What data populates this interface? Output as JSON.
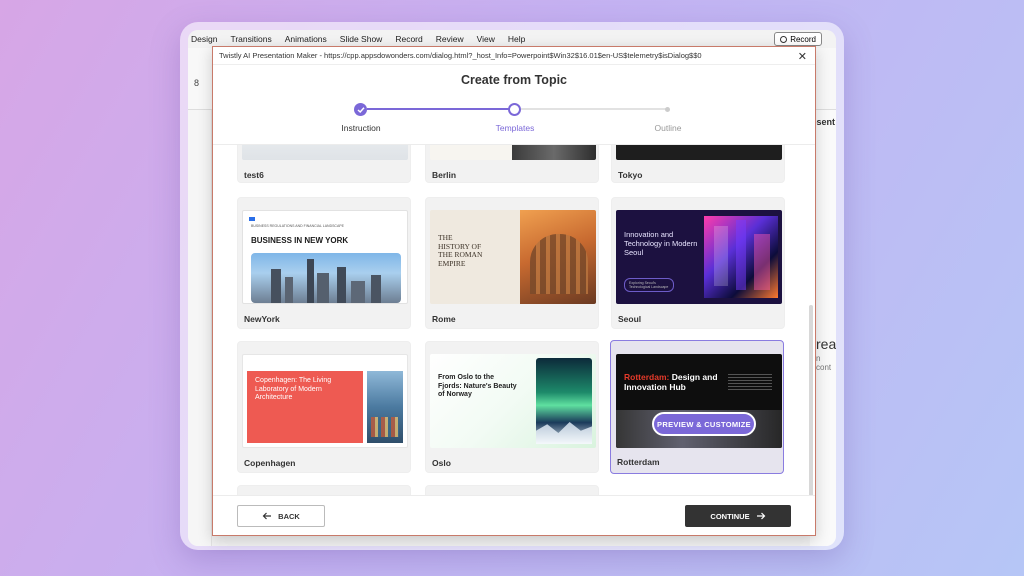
{
  "ribbon": {
    "tabs": [
      "Design",
      "Transitions",
      "Animations",
      "Slide Show",
      "Record",
      "Review",
      "View",
      "Help"
    ],
    "record_label": "Record",
    "slide_number": "8",
    "behind_text_1": "resent",
    "behind_text_2": "reat",
    "behind_text_3": "n cont"
  },
  "dialog": {
    "window_title": "Twistly AI Presentation Maker - https://cpp.appsdowonders.com/dialog.html?_host_Info=Powerpoint$Win32$16.01$en-US$telemetry$isDialog$$0",
    "close_label": "✕",
    "title": "Create from Topic",
    "steps": [
      {
        "label": "Instruction",
        "state": "done"
      },
      {
        "label": "Templates",
        "state": "active"
      },
      {
        "label": "Outline",
        "state": "pending"
      }
    ],
    "accent_color": "#7b68d8",
    "back_label": "BACK",
    "continue_label": "CONTINUE"
  },
  "templates": {
    "row0": [
      "test6",
      "Berlin",
      "Tokyo"
    ],
    "newyork": {
      "name": "NewYork",
      "kicker": "BUSINESS REGULATIONS AND FINANCIAL LANDSCAPE",
      "headline": "BUSINESS IN NEW YORK"
    },
    "rome": {
      "name": "Rome",
      "headline": "THE HISTORY OF THE ROMAN EMPIRE"
    },
    "seoul": {
      "name": "Seoul",
      "headline": "Innovation and Technology in Modern Seoul",
      "sub": "Exploring Seoul's Technological Landscape"
    },
    "copenhagen": {
      "name": "Copenhagen",
      "headline": "Copenhagen: The Living Laboratory of Modern Architecture"
    },
    "oslo": {
      "name": "Oslo",
      "headline": "From Oslo to the Fjords: Nature's Beauty of Norway"
    },
    "rotterdam": {
      "name": "Rotterdam",
      "headline_red": "Rotterdam:",
      "headline_white": " Design and Innovation Hub",
      "preview_label": "PREVIEW & CUSTOMIZE"
    }
  }
}
